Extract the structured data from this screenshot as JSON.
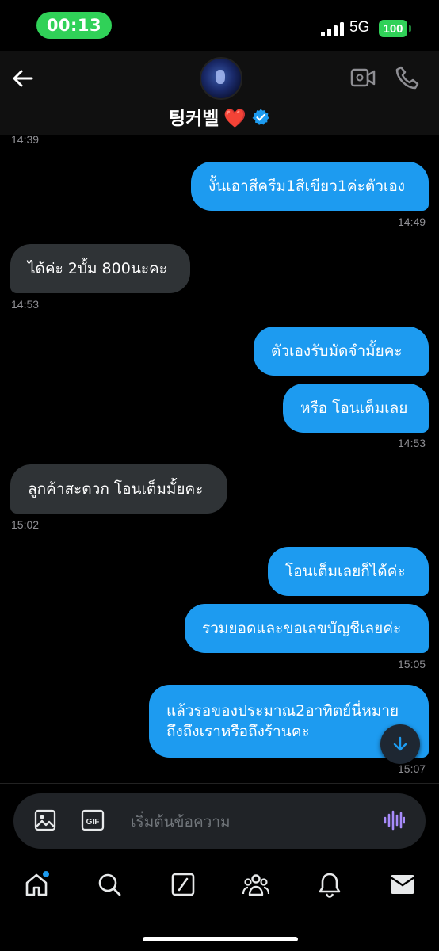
{
  "status_bar": {
    "time": "00:13",
    "network": "5G",
    "battery": "100"
  },
  "header": {
    "contact_name": "팅커벨",
    "heart": "❤️",
    "icons": [
      "back-arrow-icon",
      "video-camera-icon",
      "phone-icon",
      "verified-badge-icon"
    ]
  },
  "messages": [
    {
      "direction": "in_timestamp",
      "time": "14:39"
    },
    {
      "direction": "out",
      "text": "งั้นเอาสีครีม1สีเขียว1ค่ะตัวเอง",
      "time": "14:49"
    },
    {
      "direction": "in",
      "text": "ได้ค่ะ 2บั้ม 800นะคะ",
      "time": "14:53"
    },
    {
      "direction": "out",
      "text": "ตัวเองรับมัดจำมั้ยคะ"
    },
    {
      "direction": "out",
      "text": "หรือ โอนเต็มเลย",
      "time": "14:53"
    },
    {
      "direction": "in",
      "text": "ลูกค้าสะดวก โอนเต็มมั้ยคะ",
      "time": "15:02"
    },
    {
      "direction": "out",
      "text": "โอนเต็มเลยก็ได้ค่ะ"
    },
    {
      "direction": "out",
      "text": "รวมยอดและขอเลขบัญชีเลยค่ะ",
      "time": "15:05"
    },
    {
      "direction": "out",
      "text": "แล้วรอของประมาณ2อาทิตย์นี่หมาย ถึงถึงเราหรือถึงร้านคะ",
      "time": "15:07"
    }
  ],
  "composer": {
    "placeholder": "เริ่มต้นข้อความ",
    "gif_label": "GIF"
  },
  "nav": {
    "items": [
      "home-icon",
      "search-icon",
      "grok-icon",
      "communities-icon",
      "notifications-icon",
      "messages-icon"
    ]
  },
  "colors": {
    "outgoing_bubble": "#1d9bf0",
    "incoming_bubble": "#2f3336",
    "status_green": "#30d158",
    "voice_accent": "#a78bfa"
  }
}
